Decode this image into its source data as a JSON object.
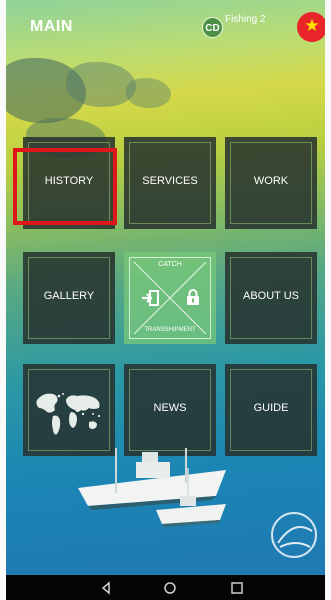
{
  "header": {
    "title": "MAIN",
    "user_initials": "CD",
    "user_name": "Fishing 2",
    "language_flag_icon": "vietnam-flag-icon",
    "flag_star": "★"
  },
  "menu": {
    "tiles": [
      {
        "id": "history",
        "label": "HISTORY",
        "selected": true
      },
      {
        "id": "services",
        "label": "SERVICES"
      },
      {
        "id": "work",
        "label": "WORK"
      },
      {
        "id": "gallery",
        "label": "GALLERY"
      },
      {
        "id": "catch-transshipment",
        "top_label": "CATCH",
        "bottom_label": "TRANSSHIPMENT",
        "icons": [
          "enter-icon",
          "lock-icon"
        ]
      },
      {
        "id": "about",
        "label": "ABOUT US"
      },
      {
        "id": "world-map",
        "icon": "world-map-icon"
      },
      {
        "id": "news",
        "label": "NEWS"
      },
      {
        "id": "guide",
        "label": "GUIDE"
      }
    ]
  },
  "nav_bar": {
    "icons": [
      "back-icon",
      "home-icon",
      "recent-apps-icon"
    ]
  },
  "colors": {
    "selection": "#e1161a",
    "tile_bg": "#26312e",
    "center_tile_bg": "#78c878",
    "flag_red": "#e8262a",
    "flag_star": "#ffe400"
  }
}
